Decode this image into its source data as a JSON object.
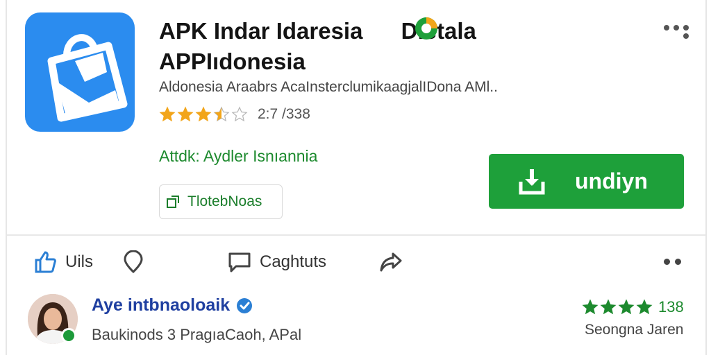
{
  "app": {
    "title": "APK Indar Idaresia",
    "title_badge_text": "Dietala",
    "title_line2": "APPIıdonesia",
    "subtitle": "Aldonesia Araabrs AcaInsterclumikaagjalIDona AMl..",
    "rating": {
      "value": 3.5,
      "max": 5,
      "text": "2:7 /338"
    },
    "author": "Attdk: Aydler Isnıannia",
    "tag_button_label": "TlotebNoas",
    "download_label": "undiyn"
  },
  "actions": {
    "like_label": "Uils",
    "comment_label": "Caghtuts"
  },
  "review": {
    "reviewer_name": "Aye intbnaoloaik",
    "text": "Baukinods 3 PragıaCaoh, APal",
    "stars": 4,
    "count": "138",
    "date": "Seongna Jaren"
  },
  "colors": {
    "brand_blue": "#2b8cef",
    "accent_green": "#1ea03a",
    "star_gold": "#f2a51a",
    "star_green": "#1d8a2e"
  },
  "icons": {
    "app": "shopping-bag-icon",
    "download": "download-icon",
    "like": "thumbs-up-icon",
    "pin": "location-pin-icon",
    "comment": "comment-icon",
    "share": "share-icon",
    "more": "more-dots-icon",
    "verified": "verified-badge-icon",
    "tag": "external-link-icon"
  }
}
